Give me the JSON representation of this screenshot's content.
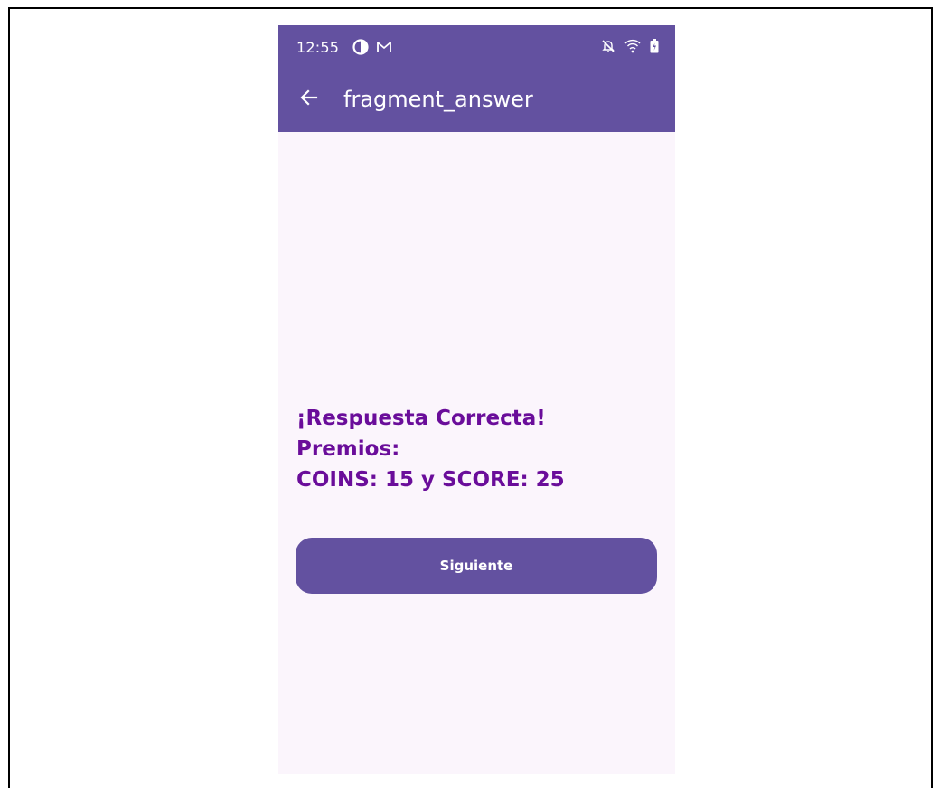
{
  "status_bar": {
    "time": "12:55",
    "left_icons": [
      "data-saver-icon",
      "gmail-icon"
    ],
    "right_icons": [
      "notifications-off-icon",
      "wifi-icon",
      "battery-icon"
    ]
  },
  "app_bar": {
    "back_icon": "arrow-back-icon",
    "title": "fragment_answer"
  },
  "result": {
    "line1": "¡Respuesta Correcta!",
    "line2": "Premios:",
    "line3": "COINS: 15 y SCORE: 25"
  },
  "actions": {
    "next_label": "Siguiente"
  },
  "colors": {
    "primary": "#6351a0",
    "background": "#fbf5fc",
    "result_text": "#6a0d9a",
    "on_primary": "#ffffff"
  }
}
